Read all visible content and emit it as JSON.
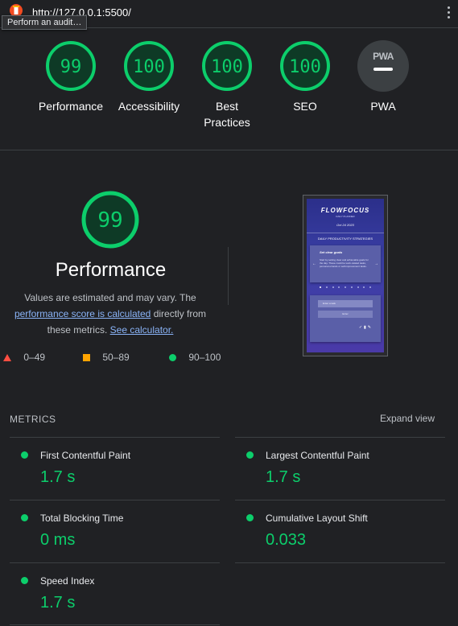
{
  "browser": {
    "url": "http://127.0.0.1:5500/",
    "tooltip": "Perform an audit…"
  },
  "scores": [
    {
      "label": "Performance",
      "value": "99",
      "color": "#0cce6b"
    },
    {
      "label": "Accessibility",
      "value": "100",
      "color": "#0cce6b"
    },
    {
      "label": "Best Practices",
      "value": "100",
      "color": "#0cce6b"
    },
    {
      "label": "SEO",
      "value": "100",
      "color": "#0cce6b"
    },
    {
      "label": "PWA",
      "badge": "PWA"
    }
  ],
  "performance": {
    "score": "99",
    "title": "Performance",
    "desc_1": "Values are estimated and may vary. The",
    "link_score": "performance score is calculated",
    "desc_2": "directly from these metrics.",
    "link_calc": "See calculator.",
    "legend": [
      "0–49",
      "50–89",
      "90–100"
    ]
  },
  "screenshot": {
    "brand": "FLOWFOCUS",
    "subtitle": "DAILY PLANNER",
    "date": "Oct 24 2023",
    "heading": "DAILY PRODUCTIVITY STRATEGIES",
    "card_title": "Set clear goals",
    "card_text": "Start by setting clear and achievable goals for the day. These could be work-related tasks, personal errands or self-improvement tasks.",
    "input_placeholder": "Enter a task",
    "button_label": "Enter"
  },
  "metrics": {
    "heading": "METRICS",
    "expand_label": "Expand view",
    "items": [
      {
        "name": "First Contentful Paint",
        "value": "1.7 s"
      },
      {
        "name": "Largest Contentful Paint",
        "value": "1.7 s"
      },
      {
        "name": "Total Blocking Time",
        "value": "0 ms"
      },
      {
        "name": "Cumulative Layout Shift",
        "value": "0.033"
      },
      {
        "name": "Speed Index",
        "value": "1.7 s"
      }
    ]
  }
}
